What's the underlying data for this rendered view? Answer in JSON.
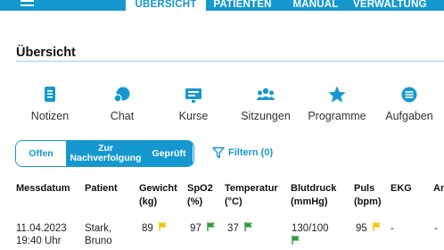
{
  "tabs": [
    {
      "label": "ÜBERSICHT",
      "active": true
    },
    {
      "label": "PATIENTEN",
      "active": false
    },
    {
      "label": "MANUAL",
      "active": false
    },
    {
      "label": "VERWALTUNG",
      "active": false
    }
  ],
  "page": {
    "title": "Übersicht"
  },
  "nav": [
    {
      "label": "Notizen",
      "icon": "notes-icon"
    },
    {
      "label": "Chat",
      "icon": "chat-icon"
    },
    {
      "label": "Kurse",
      "icon": "courses-icon"
    },
    {
      "label": "Sitzungen",
      "icon": "sessions-icon"
    },
    {
      "label": "Programme",
      "icon": "star-icon"
    },
    {
      "label": "Aufgaben",
      "icon": "tasks-icon"
    }
  ],
  "filter_tabs": [
    {
      "label": "Offen",
      "selected": true
    },
    {
      "label": "Zur Nachverfolgung",
      "selected": false
    },
    {
      "label": "Geprüft",
      "selected": false
    }
  ],
  "filter": {
    "label": "Filtern (0)",
    "icon": "filter-icon"
  },
  "table": {
    "headers": {
      "date": "Messdatum",
      "patient": "Patient",
      "weight_1": "Gewicht",
      "weight_2": "(kg)",
      "spo2_1": "SpO2",
      "spo2_2": "(%)",
      "temp_1": "Temperatur",
      "temp_2": "(°C)",
      "bp_1": "Blutdruck",
      "bp_2": "(mmHg)",
      "pulse_1": "Puls",
      "pulse_2": "(bpm)",
      "ekg": "EKG",
      "extra": "Ar"
    },
    "rows": [
      {
        "date": "11.04.2023",
        "time": "19:40 Uhr",
        "patient_last": "Stark,",
        "patient_first": "Bruno",
        "weight": "89",
        "spo2": "97",
        "temp": "37",
        "bp": "130/100",
        "pulse": "95",
        "ekg": "-",
        "extra": "-"
      }
    ]
  },
  "colors": {
    "accent": "#1598cf",
    "flag_yellow": "#f2c40f",
    "flag_green": "#2e9e3b"
  }
}
